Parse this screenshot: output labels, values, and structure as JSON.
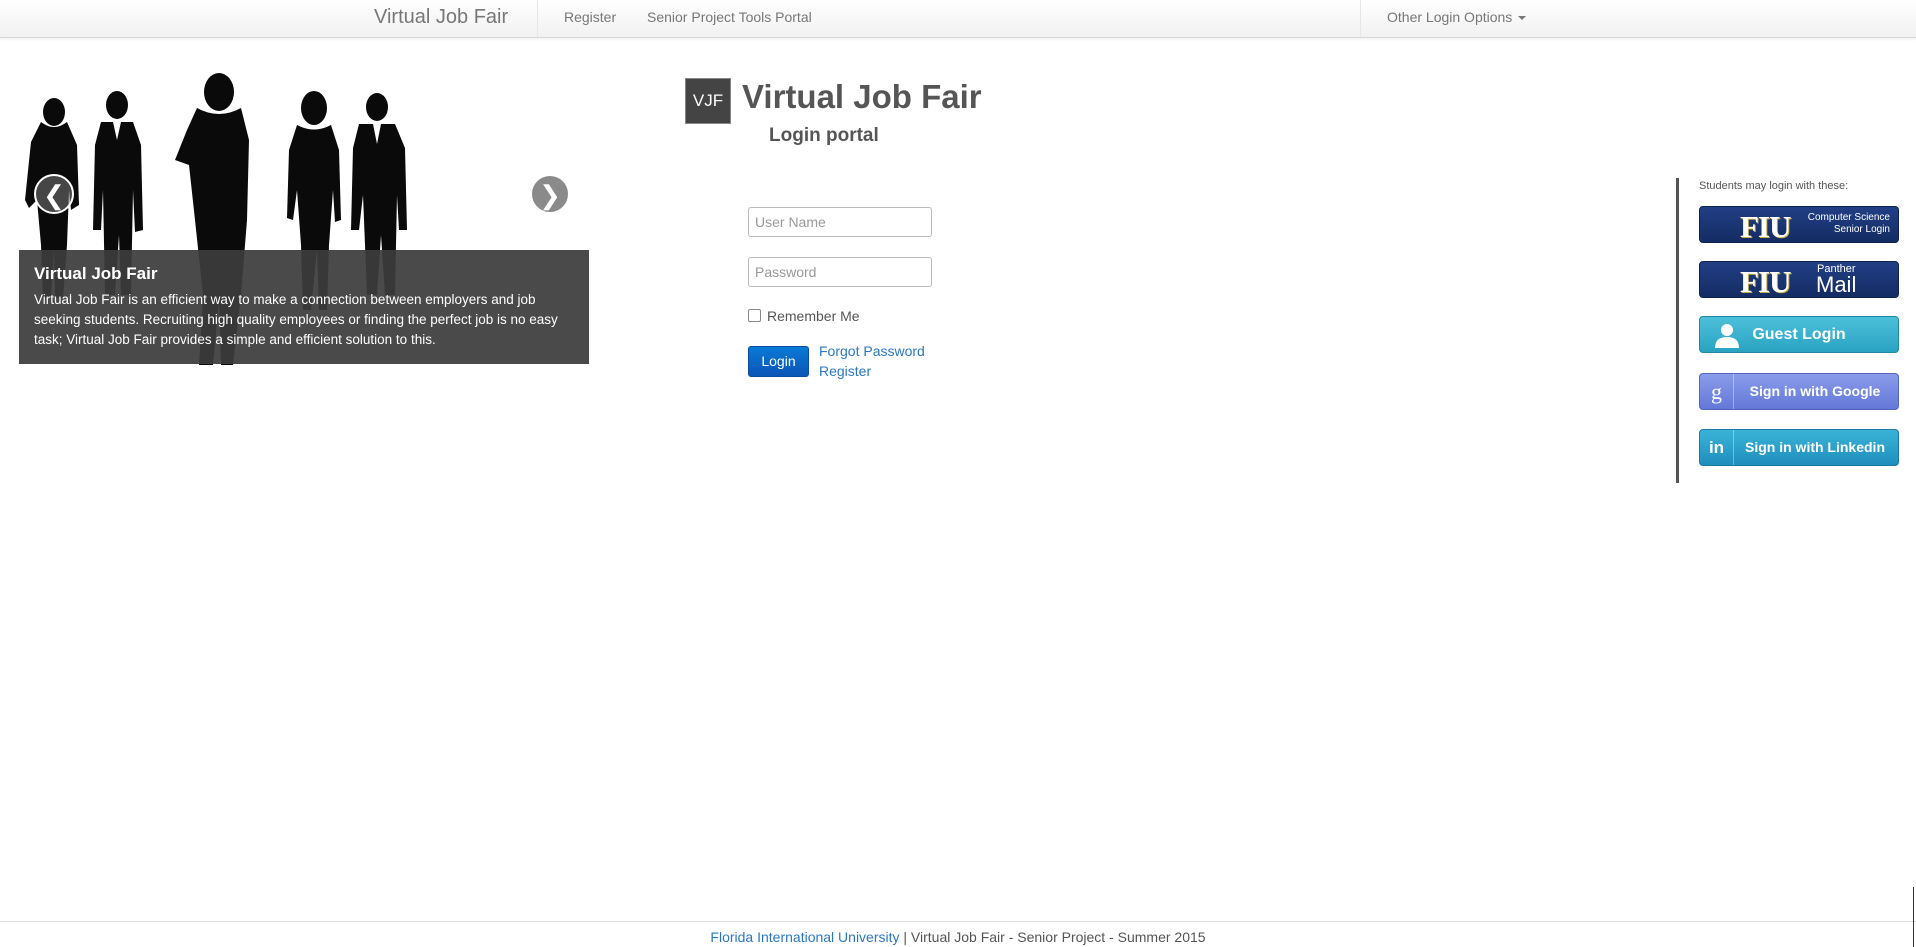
{
  "navbar": {
    "brand": "Virtual Job Fair",
    "links": [
      "Register",
      "Senior Project Tools Portal"
    ],
    "dropdown_label": "Other Login Options"
  },
  "carousel": {
    "caption_title": "Virtual Job Fair",
    "caption_text": "Virtual Job Fair is an efficient way to make a connection between employers and job seeking students. Recruiting high quality employees or finding the perfect job is no easy task; Virtual Job Fair provides a simple and efficient solution to this.",
    "prev_glyph": "❮",
    "next_glyph": "❯"
  },
  "header": {
    "logo_text": "VJF",
    "title": "Virtual Job Fair",
    "subtitle": "Login portal"
  },
  "login_form": {
    "username_placeholder": "User Name",
    "password_placeholder": "Password",
    "remember_label": "Remember Me",
    "remember_checked": false,
    "login_label": "Login",
    "forgot_label": "Forgot Password",
    "register_label": "Register"
  },
  "sso": {
    "intro": "Students may login with these:",
    "fiu_cs": {
      "mark": "FIU",
      "line1": "Computer Science",
      "line2": "Senior Login"
    },
    "fiu_mail": {
      "mark": "FIU",
      "small": "Panther",
      "big": "Mail"
    },
    "guest": "Guest Login",
    "google": {
      "icon": "g",
      "label": "Sign in with Google"
    },
    "linkedin": {
      "icon": "in",
      "label": "Sign in with Linkedin"
    }
  },
  "footer": {
    "university_link": "Florida International University",
    "rest": " | Virtual Job Fair - Senior Project - Summer 2015"
  },
  "colors": {
    "link": "#2a78c2",
    "login_button": "#0a66c6",
    "fiu_navy": "#1a3370",
    "guest": "#38b2d0",
    "google": "#7589e2",
    "linkedin": "#2aa0cb"
  }
}
